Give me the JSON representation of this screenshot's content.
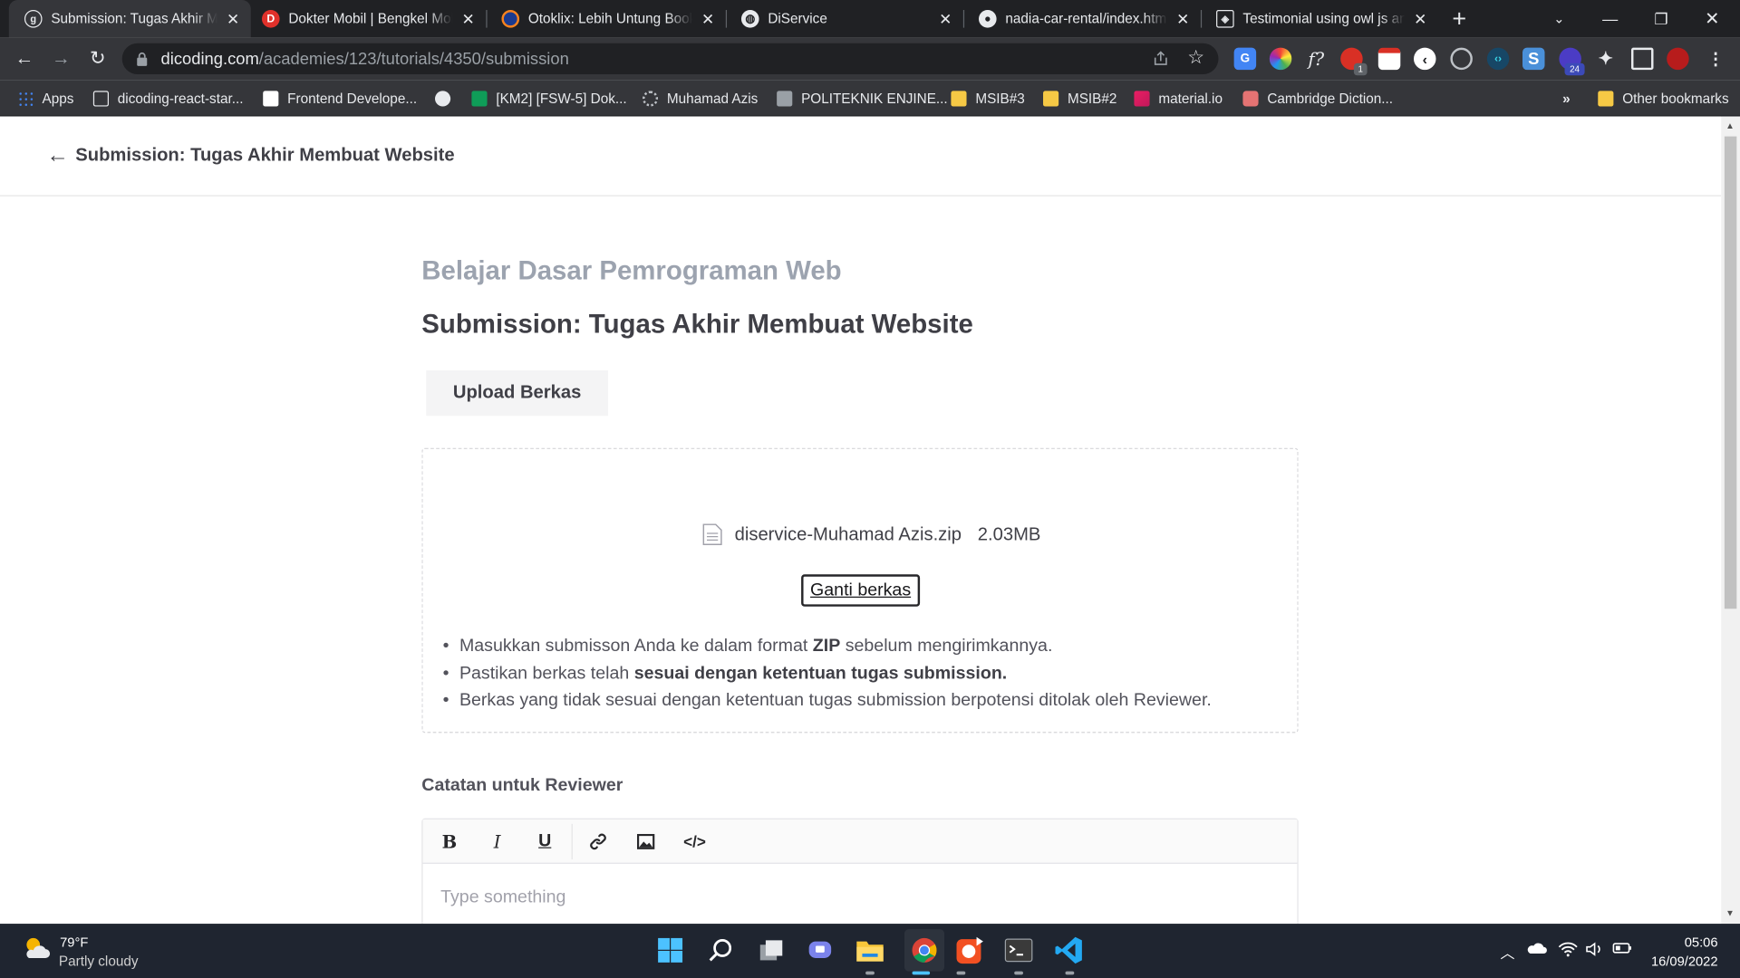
{
  "browser": {
    "tabs": [
      {
        "title": "Submission: Tugas Akhir Me",
        "active": true,
        "favicon": "dicoding-icon"
      },
      {
        "title": "Dokter Mobil | Bengkel Mol",
        "active": false,
        "favicon": "dokter-mobil-icon"
      },
      {
        "title": "Otoklix: Lebih Untung Book",
        "active": false,
        "favicon": "otoklix-icon"
      },
      {
        "title": "DiService",
        "active": false,
        "favicon": "globe-icon"
      },
      {
        "title": "nadia-car-rental/index.html",
        "active": false,
        "favicon": "github-icon"
      },
      {
        "title": "Testimonial using owl js and",
        "active": false,
        "favicon": "codepen-icon"
      }
    ],
    "url_host": "dicoding.com",
    "url_path": "/academies/123/tutorials/4350/submission",
    "extension_badges": {
      "notifications": "1",
      "counter": "24"
    },
    "bookmarks": [
      {
        "label": "Apps",
        "icon": "apps-grid-icon"
      },
      {
        "label": "dicoding-react-star...",
        "icon": "page-icon"
      },
      {
        "label": "Frontend Develope...",
        "icon": "frontend-icon"
      },
      {
        "label": "",
        "icon": "globe-icon"
      },
      {
        "label": "[KM2] [FSW-5] Dok...",
        "icon": "sheets-icon"
      },
      {
        "label": "Muhamad Azis",
        "icon": "gear-icon"
      },
      {
        "label": "POLITEKNIK ENJINE...",
        "icon": "politeknik-icon"
      },
      {
        "label": "MSIB#3",
        "icon": "folder-icon"
      },
      {
        "label": "MSIB#2",
        "icon": "folder-icon"
      },
      {
        "label": "material.io",
        "icon": "material-icon"
      },
      {
        "label": "Cambridge Diction...",
        "icon": "cambridge-icon"
      }
    ],
    "overflow": "»",
    "other_bookmarks": "Other bookmarks"
  },
  "page": {
    "header_title": "Submission: Tugas Akhir Membuat Website",
    "course_name": "Belajar Dasar Pemrograman Web",
    "submission_title": "Submission: Tugas Akhir Membuat Website",
    "upload_button": "Upload Berkas",
    "file": {
      "name": "diservice-Muhamad Azis.zip",
      "size": "2.03MB"
    },
    "change_file_button": "Ganti berkas",
    "notes": {
      "n1_pre": "Masukkan submisson Anda ke dalam format ",
      "n1_bold": "ZIP",
      "n1_post": " sebelum mengirimkannya.",
      "n2_pre": "Pastikan berkas telah ",
      "n2_bold": "sesuai dengan ketentuan tugas submission.",
      "n3": "Berkas yang tidak sesuai dengan ketentuan tugas submission berpotensi ditolak oleh Reviewer."
    },
    "reviewer_label": "Catatan untuk Reviewer",
    "editor": {
      "bold": "B",
      "italic": "I",
      "underline": "U",
      "placeholder": "Type something"
    }
  },
  "taskbar": {
    "temperature": "79°F",
    "condition": "Partly cloudy",
    "time": "05:06",
    "date": "16/09/2022"
  }
}
